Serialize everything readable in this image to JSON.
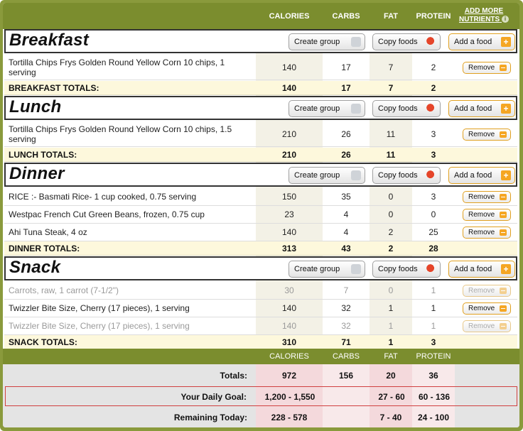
{
  "header": {
    "calories": "CALORIES",
    "carbs": "CARBS",
    "fat": "FAT",
    "protein": "PROTEIN",
    "add_more_line1": "ADD MORE",
    "add_more_line2": "NUTRIENTS",
    "info": "i"
  },
  "buttons": {
    "create_group": "Create group",
    "copy_foods": "Copy foods",
    "add_food": "Add a food",
    "remove": "Remove"
  },
  "breakfast": {
    "title": "Breakfast",
    "items": [
      {
        "name": "Tortilla Chips Frys Golden Round Yellow Corn 10 chips, 1 serving",
        "cal": "140",
        "carbs": "17",
        "fat": "7",
        "protein": "2"
      }
    ],
    "totals": {
      "label": "BREAKFAST TOTALS:",
      "cal": "140",
      "carbs": "17",
      "fat": "7",
      "protein": "2"
    }
  },
  "lunch": {
    "title": "Lunch",
    "items": [
      {
        "name": "Tortilla Chips Frys Golden Round Yellow Corn 10 chips, 1.5 serving",
        "cal": "210",
        "carbs": "26",
        "fat": "11",
        "protein": "3"
      }
    ],
    "totals": {
      "label": "LUNCH TOTALS:",
      "cal": "210",
      "carbs": "26",
      "fat": "11",
      "protein": "3"
    }
  },
  "dinner": {
    "title": "Dinner",
    "items": [
      {
        "name": "RICE :- Basmati Rice- 1 cup cooked, 0.75 serving",
        "cal": "150",
        "carbs": "35",
        "fat": "0",
        "protein": "3"
      },
      {
        "name": "Westpac French Cut Green Beans, frozen, 0.75 cup",
        "cal": "23",
        "carbs": "4",
        "fat": "0",
        "protein": "0"
      },
      {
        "name": "Ahi Tuna Steak, 4 oz",
        "cal": "140",
        "carbs": "4",
        "fat": "2",
        "protein": "25"
      }
    ],
    "totals": {
      "label": "DINNER TOTALS:",
      "cal": "313",
      "carbs": "43",
      "fat": "2",
      "protein": "28"
    }
  },
  "snack": {
    "title": "Snack",
    "items": [
      {
        "name": "Carrots, raw, 1 carrot (7-1/2\")",
        "cal": "30",
        "carbs": "7",
        "fat": "0",
        "protein": "1"
      },
      {
        "name": "Twizzler Bite Size, Cherry (17 pieces), 1 serving",
        "cal": "140",
        "carbs": "32",
        "fat": "1",
        "protein": "1"
      },
      {
        "name": "Twizzler Bite Size, Cherry (17 pieces), 1 serving",
        "cal": "140",
        "carbs": "32",
        "fat": "1",
        "protein": "1"
      }
    ],
    "totals": {
      "label": "SNACK TOTALS:",
      "cal": "310",
      "carbs": "71",
      "fat": "1",
      "protein": "3"
    }
  },
  "summary": {
    "header": {
      "calories": "CALORIES",
      "carbs": "CARBS",
      "fat": "FAT",
      "protein": "PROTEIN"
    },
    "totals": {
      "label": "Totals:",
      "cal": "972",
      "carbs": "156",
      "fat": "20",
      "protein": "36"
    },
    "goal": {
      "label": "Your Daily Goal:",
      "cal": "1,200 - 1,550",
      "carbs": "",
      "fat": "27 - 60",
      "protein": "60 - 136"
    },
    "remaining": {
      "label": "Remaining Today:",
      "cal": "228 - 578",
      "carbs": "",
      "fat": "7 - 40",
      "protein": "24 - 100"
    }
  },
  "colors": {
    "brand_green": "#7b8d2e",
    "accent_orange": "#f5a623",
    "totals_bg": "#fdf8dc",
    "goal_border": "#d04040"
  }
}
